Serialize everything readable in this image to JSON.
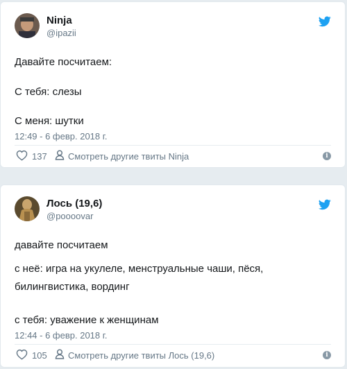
{
  "accent_color": "#1da1f2",
  "tweets": [
    {
      "author_name": "Ninja",
      "author_handle": "@ipazii",
      "lines": [
        "Давайте посчитаем:",
        "С тебя: слезы",
        "С меня: шутки"
      ],
      "timestamp": "12:49 - 6 февр. 2018 г.",
      "likes": "137",
      "more_tweets_label": "Смотреть другие твиты Ninja",
      "icons": [
        "avatar",
        "twitter-bird-icon",
        "heart-icon",
        "person-icon",
        "info-icon"
      ]
    },
    {
      "author_name": "Лось (19,6)",
      "author_handle": "@poooovar",
      "lines": [
        "давайте посчитаем",
        "с неё: игра на укулеле, менструальные чаши, пёся,",
        "билингвистика, вординг",
        "с тебя: уважение к женщинам"
      ],
      "timestamp": "12:44 - 6 февр. 2018 г.",
      "likes": "105",
      "more_tweets_label": "Смотреть другие твиты Лось (19,6)",
      "icons": [
        "avatar",
        "twitter-bird-icon",
        "heart-icon",
        "person-icon",
        "info-icon"
      ]
    }
  ]
}
